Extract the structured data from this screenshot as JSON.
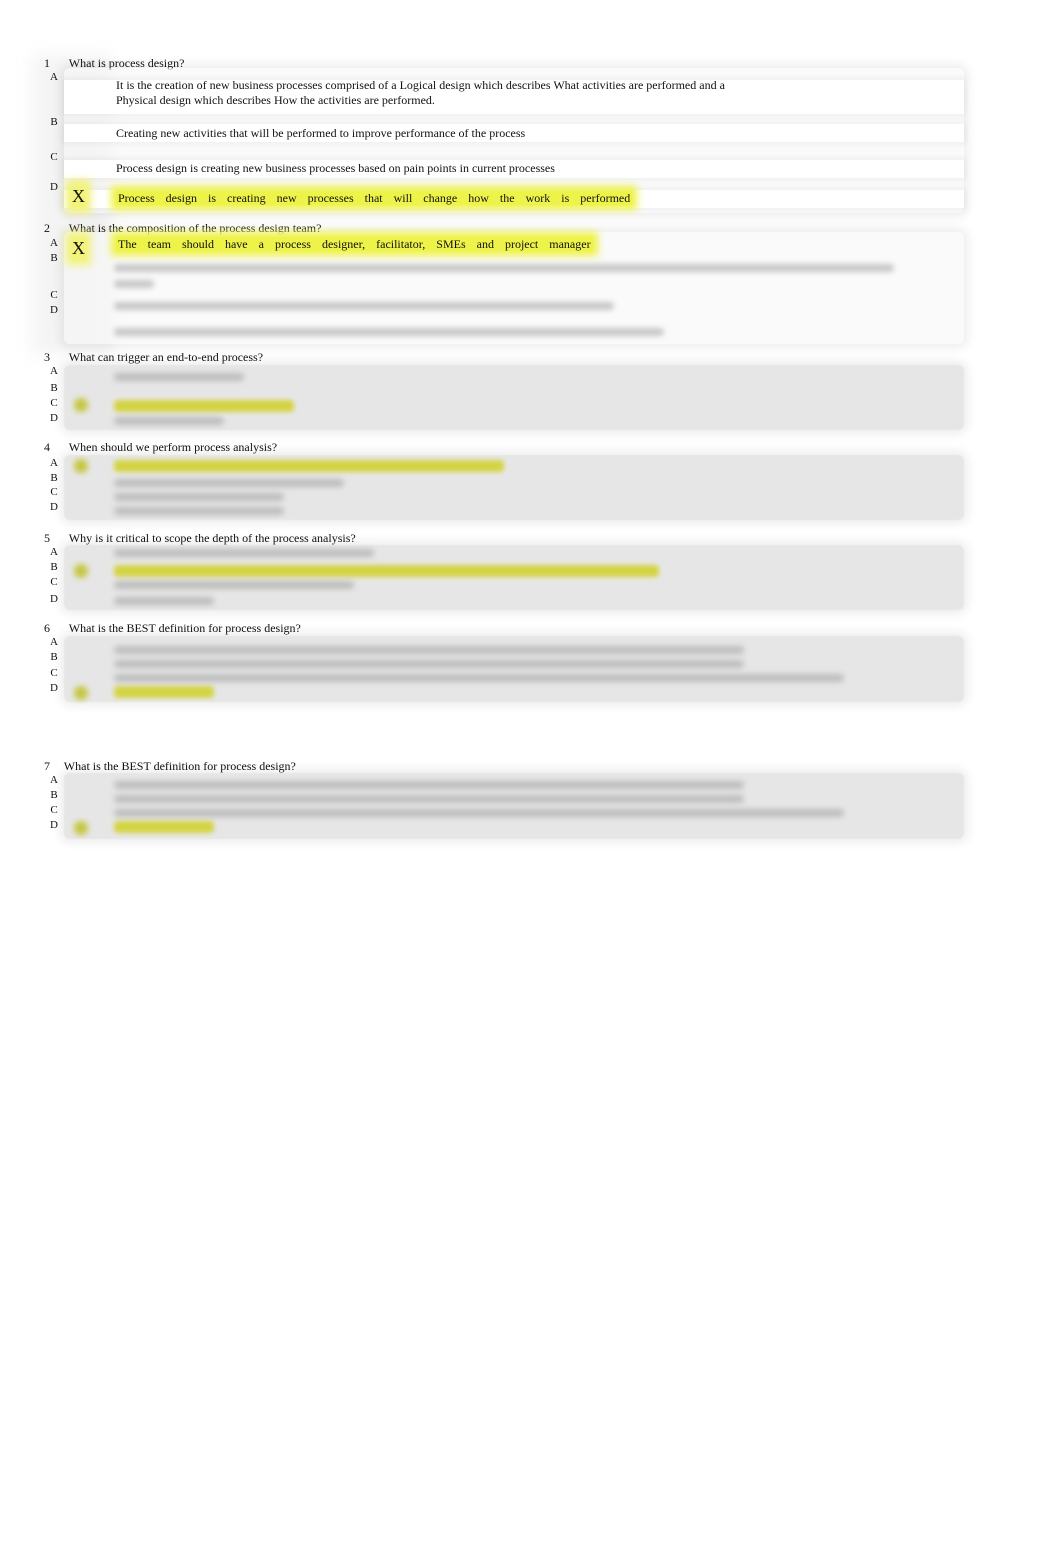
{
  "document": {
    "highlight_color": "#eef34a",
    "questions": [
      {
        "number": "1",
        "text": "What is process design?",
        "options": [
          {
            "letter": "A",
            "text_lines": [
              "It is the creation of new business processes comprised of a Logical design which describes What activities are performed and a",
              "Physical design which describes How the activities are performed."
            ],
            "selected": false
          },
          {
            "letter": "B",
            "text_lines": [
              "Creating new activities that will be performed to improve performance of the process"
            ],
            "selected": false
          },
          {
            "letter": "C",
            "text_lines": [
              "Process design is creating new business processes based on pain points in current processes"
            ],
            "selected": false
          },
          {
            "letter": "D",
            "text_lines": [
              "Process design is creating new processes that will change how the work is performed"
            ],
            "selected": true,
            "mark": "X"
          }
        ]
      },
      {
        "number": "2",
        "text": "What is the composition of the process design team?",
        "options": [
          {
            "letter": "A",
            "text_lines": [
              "The team should have a process designer, facilitator, SMEs and project manager"
            ],
            "selected": true,
            "mark": "X"
          },
          {
            "letter": "B",
            "text_lines": [],
            "selected": false,
            "obscured": true
          },
          {
            "letter": "C",
            "text_lines": [],
            "selected": false,
            "obscured": true
          },
          {
            "letter": "D",
            "text_lines": [],
            "selected": false,
            "obscured": true
          }
        ]
      },
      {
        "number": "3",
        "text": "What can trigger an end-to-end process?",
        "options": [
          {
            "letter": "A",
            "obscured": true,
            "selected": false
          },
          {
            "letter": "B",
            "obscured": true,
            "selected": false
          },
          {
            "letter": "C",
            "obscured": true,
            "selected": true
          },
          {
            "letter": "D",
            "obscured": true,
            "selected": false
          }
        ]
      },
      {
        "number": "4",
        "text": "When should we perform process analysis?",
        "options": [
          {
            "letter": "A",
            "obscured": true,
            "selected": true
          },
          {
            "letter": "B",
            "obscured": true,
            "selected": false
          },
          {
            "letter": "C",
            "obscured": true,
            "selected": false
          },
          {
            "letter": "D",
            "obscured": true,
            "selected": false
          }
        ]
      },
      {
        "number": "5",
        "text": "Why is it critical to scope the depth of the process analysis?",
        "options": [
          {
            "letter": "A",
            "obscured": true,
            "selected": false
          },
          {
            "letter": "B",
            "obscured": true,
            "selected": true
          },
          {
            "letter": "C",
            "obscured": true,
            "selected": false
          },
          {
            "letter": "D",
            "obscured": true,
            "selected": false
          }
        ]
      },
      {
        "number": "6",
        "text": "What is the BEST definition for process design?",
        "options": [
          {
            "letter": "A",
            "obscured": true,
            "selected": false
          },
          {
            "letter": "B",
            "obscured": true,
            "selected": false
          },
          {
            "letter": "C",
            "obscured": true,
            "selected": false
          },
          {
            "letter": "D",
            "obscured": true,
            "selected": true
          }
        ]
      },
      {
        "number": "7",
        "text": "What is the BEST definition for process design?",
        "options": [
          {
            "letter": "A",
            "obscured": true,
            "selected": false
          },
          {
            "letter": "B",
            "obscured": true,
            "selected": false
          },
          {
            "letter": "C",
            "obscured": true,
            "selected": false
          },
          {
            "letter": "D",
            "obscured": true,
            "selected": true
          }
        ]
      }
    ]
  }
}
